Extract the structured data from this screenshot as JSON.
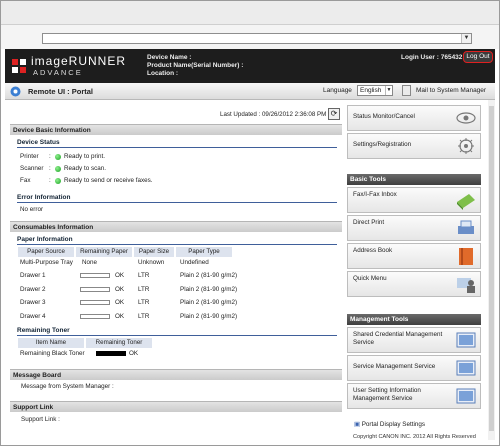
{
  "header": {
    "brand": "imageRUNNER",
    "brand_sub": "ADVANCE",
    "device_name_label": "Device Name :",
    "product_name_label": "Product Name(Serial Number) :",
    "location_label": "Location :",
    "login_user": "Login User : 765432",
    "logout": "Log Out"
  },
  "subbar": {
    "title": "Remote UI : Portal",
    "language_label": "Language",
    "language_value": "English",
    "mail_link": "Mail to System Manager"
  },
  "updated": "Last Updated : 09/26/2012 2:36:08 PM",
  "sections": {
    "device_basic": "Device Basic Information",
    "device_status": "Device Status",
    "error_info": "Error Information",
    "consumables": "Consumables Information",
    "paper_info": "Paper Information",
    "remaining_toner": "Remaining Toner",
    "message_board": "Message Board",
    "support_link": "Support Link"
  },
  "status": [
    {
      "label": "Printer",
      "value": "Ready to print."
    },
    {
      "label": "Scanner",
      "value": "Ready to scan."
    },
    {
      "label": "Fax",
      "value": "Ready to send or receive faxes."
    }
  ],
  "error_text": "No error",
  "paper": {
    "headers": [
      "Paper Source",
      "Remaining Paper",
      "Paper Size",
      "Paper Type"
    ],
    "rows": [
      {
        "source": "Multi-Purpose Tray",
        "remaining": "None",
        "size": "Unknown",
        "type": "Undefined"
      },
      {
        "source": "Drawer 1",
        "remaining": "OK",
        "size": "LTR",
        "type": "Plain 2 (81-90 g/m2)"
      },
      {
        "source": "Drawer 2",
        "remaining": "OK",
        "size": "LTR",
        "type": "Plain 2 (81-90 g/m2)"
      },
      {
        "source": "Drawer 3",
        "remaining": "OK",
        "size": "LTR",
        "type": "Plain 2 (81-90 g/m2)"
      },
      {
        "source": "Drawer 4",
        "remaining": "OK",
        "size": "LTR",
        "type": "Plain 2 (81-90 g/m2)"
      }
    ]
  },
  "toner": {
    "headers": [
      "Item Name",
      "Remaining Toner"
    ],
    "row": {
      "name": "Remaining Black Toner",
      "value": "OK"
    }
  },
  "message_text": "Message from System Manager :",
  "support_text": "Support Link :",
  "right": {
    "status_monitor": "Status Monitor/Cancel",
    "settings": "Settings/Registration",
    "basic_tools": "Basic Tools",
    "fax_inbox": "Fax/I-Fax Inbox",
    "direct_print": "Direct Print",
    "address_book": "Address Book",
    "quick_menu": "Quick Menu",
    "management_tools": "Management Tools",
    "shared_credential": "Shared Credential Management Service",
    "service_management": "Service Management Service",
    "user_setting": "User Setting Information Management Service",
    "portal_display": "Portal Display Settings",
    "copyright": "Copyright CANON INC. 2012 All Rights Reserved"
  },
  "colors": {
    "header_bg": "#1d1d1d",
    "logout_border": "#e02020",
    "status_dot": "#18a020"
  }
}
